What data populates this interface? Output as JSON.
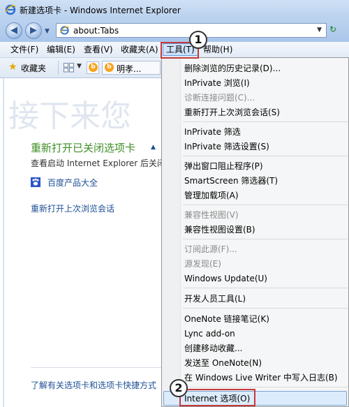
{
  "window": {
    "title": "新建选项卡 - Windows Internet Explorer"
  },
  "navbar": {
    "address": "about:Tabs"
  },
  "menubar": {
    "items": [
      "文件(F)",
      "编辑(E)",
      "查看(V)",
      "收藏夹(A)",
      "工具(T)",
      "帮助(H)"
    ]
  },
  "favbar": {
    "label": "收藏夹",
    "tab2_label": "明孝..."
  },
  "content": {
    "watermark": "接下来您",
    "reopen_heading": "重新打开已关闭选项卡",
    "reopen_desc": "查看启动 Internet Explorer 后关闭",
    "baidu_link": "百度产品大全",
    "last_session": "重新打开上次浏览会话",
    "shortcut_link": "了解有关选项卡和选项卡快捷方式"
  },
  "tools_menu": {
    "items": [
      {
        "label": "删除浏览的历史记录(D)...",
        "enabled": true
      },
      {
        "label": "InPrivate 浏览(I)",
        "enabled": true
      },
      {
        "label": "诊断连接问题(C)...",
        "enabled": false
      },
      {
        "label": "重新打开上次浏览会话(S)",
        "enabled": true
      },
      {
        "label": "InPrivate 筛选",
        "enabled": true
      },
      {
        "label": "InPrivate 筛选设置(S)",
        "enabled": true
      },
      {
        "label": "弹出窗口阻止程序(P)",
        "enabled": true
      },
      {
        "label": "SmartScreen 筛选器(T)",
        "enabled": true
      },
      {
        "label": "管理加载项(A)",
        "enabled": true
      },
      {
        "label": "兼容性视图(V)",
        "enabled": false
      },
      {
        "label": "兼容性视图设置(B)",
        "enabled": true
      },
      {
        "label": "订阅此源(F)...",
        "enabled": false
      },
      {
        "label": "源发现(E)",
        "enabled": false
      },
      {
        "label": "Windows Update(U)",
        "enabled": true
      },
      {
        "label": "开发人员工具(L)",
        "enabled": true
      },
      {
        "label": "OneNote 链接笔记(K)",
        "enabled": true
      },
      {
        "label": "Lync add-on",
        "enabled": true
      },
      {
        "label": "创建移动收藏...",
        "enabled": true
      },
      {
        "label": "发送至 OneNote(N)",
        "enabled": true
      },
      {
        "label": "在 Windows Live Writer 中写入日志(B)",
        "enabled": true
      },
      {
        "label": "Internet 选项(O)",
        "enabled": true,
        "highlighted": true
      }
    ]
  },
  "callouts": {
    "first": "1",
    "second": "2"
  },
  "colors": {
    "accent": "#5e9ae2",
    "callout_border": "#c53a3a",
    "link": "#1e4f96",
    "heading_green": "#3f8f26"
  }
}
